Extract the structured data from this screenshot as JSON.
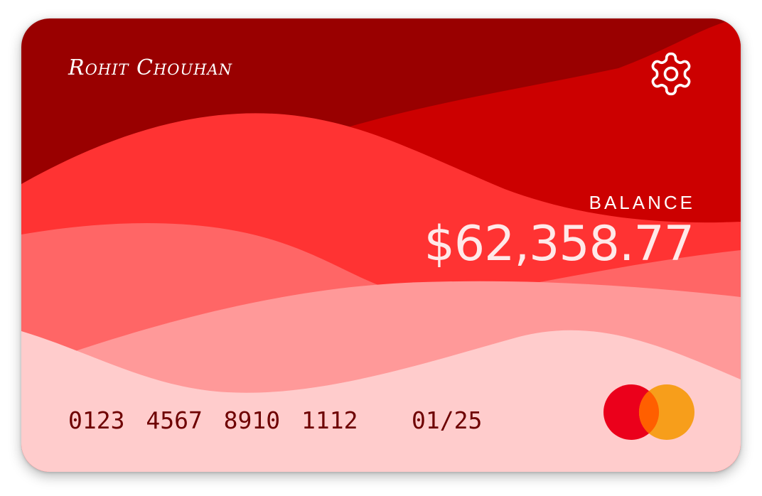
{
  "card": {
    "holder_name": "Rohit Chouhan",
    "settings_icon": "gear-icon",
    "balance_label": "BALANCE",
    "balance_amount": "$62,358.77",
    "number": "0123 4567 8910 1112",
    "expiry": "01/25",
    "brand_icon": "mastercard-logo-icon"
  },
  "colors": {
    "wave_darkest": "#990000",
    "wave_dark": "#cc0000",
    "wave_mid": "#ff3333",
    "wave_light": "#ff6666",
    "wave_lighter": "#ff9999",
    "wave_lightest": "#ffcccc",
    "text_light": "#ffffff",
    "text_dark": "#6e0000",
    "logo_red": "#eb001b",
    "logo_orange": "#f79e1b",
    "logo_overlap": "#ff5f00"
  }
}
